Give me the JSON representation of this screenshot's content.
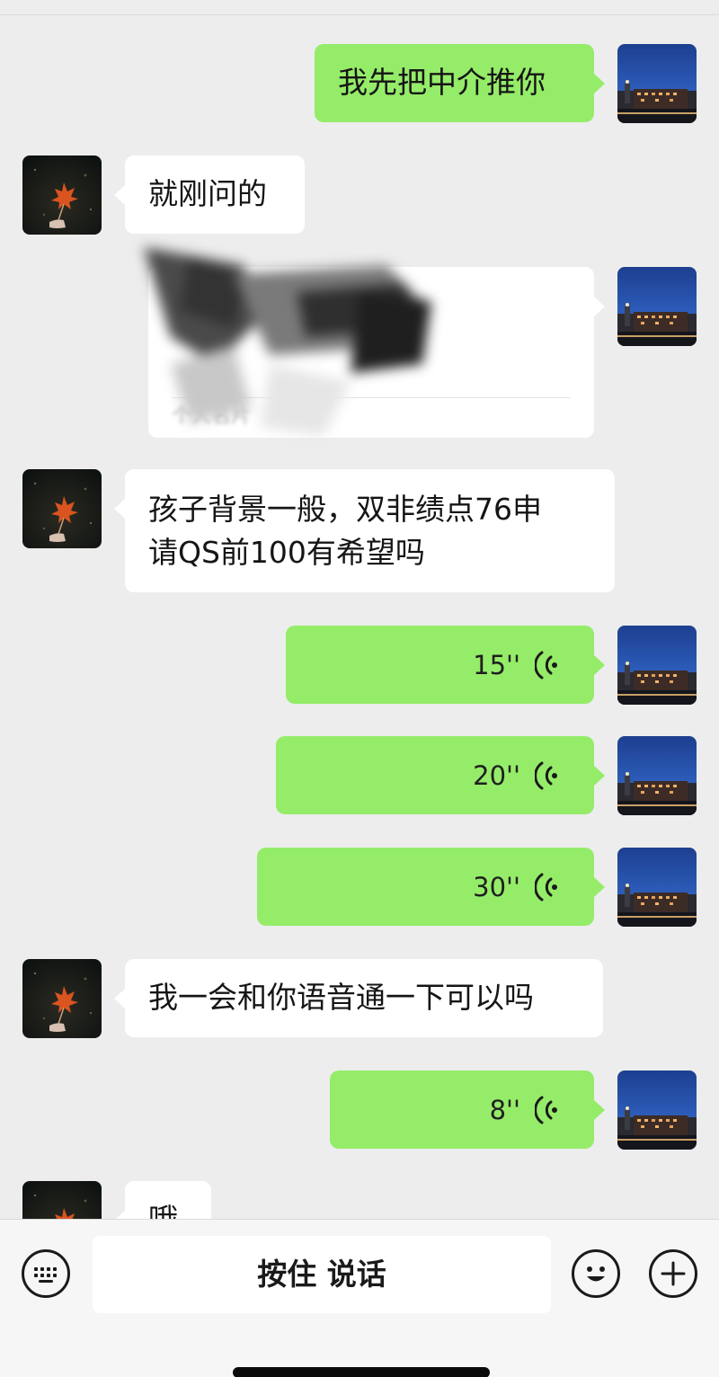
{
  "messages": [
    {
      "side": "right",
      "type": "text",
      "text": "我先把中介推你"
    },
    {
      "side": "left",
      "type": "text",
      "text": "就刚问的"
    },
    {
      "side": "right",
      "type": "contact_card",
      "footer": "个人名片",
      "redacted": true
    },
    {
      "side": "left",
      "type": "text",
      "lines": [
        "孩子背景一般，双非绩点76申",
        "请QS前100有希望吗"
      ]
    },
    {
      "side": "right",
      "type": "voice",
      "duration": "15''"
    },
    {
      "side": "right",
      "type": "voice",
      "duration": "20''"
    },
    {
      "side": "right",
      "type": "voice",
      "duration": "30''"
    },
    {
      "side": "left",
      "type": "text",
      "text": "我一会和你语音通一下可以吗"
    },
    {
      "side": "right",
      "type": "voice",
      "duration": "8''"
    },
    {
      "side": "left",
      "type": "text",
      "text": "哦"
    }
  ],
  "input_bar": {
    "hold_to_talk_label": "按住 说话",
    "left_icon": "keyboard-icon",
    "emoji_icon": "emoji-icon",
    "plus_icon": "plus-icon"
  },
  "colors": {
    "background": "#ededed",
    "outgoing_bubble": "#95ec69",
    "incoming_bubble": "#ffffff"
  }
}
